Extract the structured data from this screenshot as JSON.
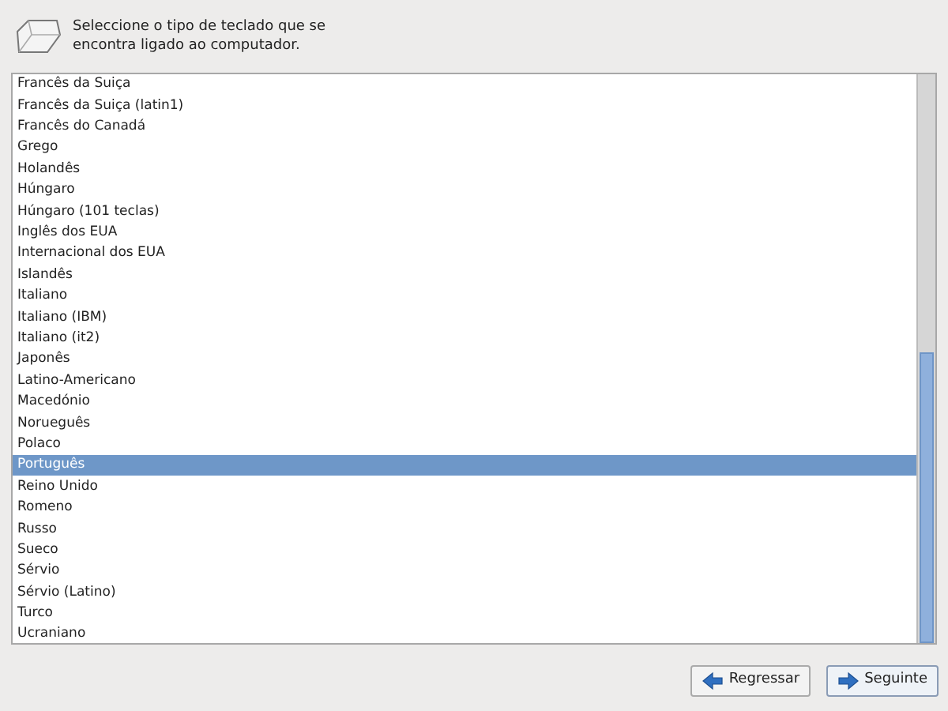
{
  "header": {
    "text": "Seleccione o tipo de teclado que se encontra ligado ao computador."
  },
  "layouts": [
    {
      "label": "Francês da Suiça",
      "selected": false
    },
    {
      "label": "Francês da Suiça (latin1)",
      "selected": false
    },
    {
      "label": "Francês do Canadá",
      "selected": false
    },
    {
      "label": "Grego",
      "selected": false
    },
    {
      "label": "Holandês",
      "selected": false
    },
    {
      "label": "Húngaro",
      "selected": false
    },
    {
      "label": "Húngaro (101 teclas)",
      "selected": false
    },
    {
      "label": "Inglês dos EUA",
      "selected": false
    },
    {
      "label": "Internacional dos EUA",
      "selected": false
    },
    {
      "label": "Islandês",
      "selected": false
    },
    {
      "label": "Italiano",
      "selected": false
    },
    {
      "label": "Italiano (IBM)",
      "selected": false
    },
    {
      "label": "Italiano (it2)",
      "selected": false
    },
    {
      "label": "Japonês",
      "selected": false
    },
    {
      "label": "Latino-Americano",
      "selected": false
    },
    {
      "label": "Macedónio",
      "selected": false
    },
    {
      "label": "Norueguês",
      "selected": false
    },
    {
      "label": "Polaco",
      "selected": false
    },
    {
      "label": "Português",
      "selected": true
    },
    {
      "label": "Reino Unido",
      "selected": false
    },
    {
      "label": "Romeno",
      "selected": false
    },
    {
      "label": "Russo",
      "selected": false
    },
    {
      "label": "Sueco",
      "selected": false
    },
    {
      "label": "Sérvio",
      "selected": false
    },
    {
      "label": "Sérvio (Latino)",
      "selected": false
    },
    {
      "label": "Turco",
      "selected": false
    },
    {
      "label": "Ucraniano",
      "selected": false
    }
  ],
  "buttons": [
    {
      "label": "Regressar",
      "kind": "back"
    },
    {
      "label": "Seguinte",
      "kind": "next"
    }
  ]
}
